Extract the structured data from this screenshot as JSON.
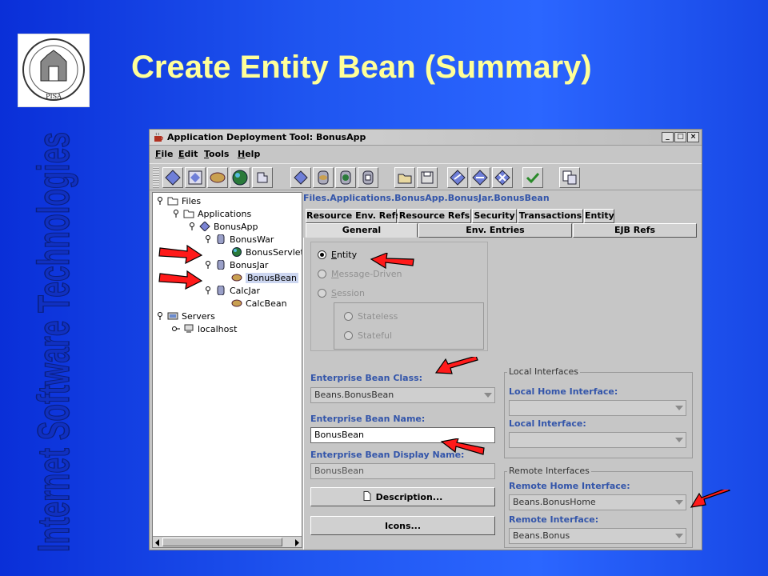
{
  "slide": {
    "title": "Create Entity Bean (Summary)",
    "side_title": "Internet Software Technologies",
    "logo_text": "PISA"
  },
  "window": {
    "title": "Application Deployment Tool: BonusApp",
    "controls": [
      "_",
      "□",
      "×"
    ],
    "menus": [
      {
        "letter": "F",
        "rest": "ile"
      },
      {
        "letter": "E",
        "rest": "dit"
      },
      {
        "letter": "T",
        "rest": "ools"
      },
      {
        "letter": "H",
        "rest": "elp"
      }
    ]
  },
  "tree": {
    "files": "Files",
    "applications": "Applications",
    "bonusapp": "BonusApp",
    "bonuswar": "BonusWar",
    "bonusservlet": "BonusServlet",
    "bonusjar": "BonusJar",
    "bonusbean": "BonusBean",
    "calcjar": "CalcJar",
    "calcbean": "CalcBean",
    "servers": "Servers",
    "localhost": "localhost"
  },
  "panel": {
    "path": "Files.Applications.BonusApp.BonusJar.BonusBean",
    "tabs_row1": [
      "Resource Env. Refs",
      "Resource Refs",
      "Security",
      "Transactions",
      "Entity"
    ],
    "tabs_row2": [
      "General",
      "Env. Entries",
      "EJB Refs"
    ],
    "radios": {
      "entity": {
        "letter": "E",
        "rest": "ntity"
      },
      "message": {
        "letter": "M",
        "rest": "essage-Driven"
      },
      "session": {
        "letter": "S",
        "rest": "ession"
      },
      "stateless": "Stateless",
      "stateful": "Stateful"
    },
    "ejb_class_label": "Enterprise Bean Class:",
    "ejb_class_value": "Beans.BonusBean",
    "ejb_name_label": "Enterprise Bean Name:",
    "ejb_name_value": "BonusBean",
    "ejb_display_label": "Enterprise Bean Display Name:",
    "ejb_display_value": "BonusBean",
    "description_button": "Description...",
    "icons_button": "Icons...",
    "local_group": "Local Interfaces",
    "local_home_label": "Local Home Interface:",
    "local_label": "Local Interface:",
    "remote_group": "Remote Interfaces",
    "remote_home_label": "Remote Home Interface:",
    "remote_home_value": "Beans.BonusHome",
    "remote_label": "Remote Interface:",
    "remote_value": "Beans.Bonus"
  },
  "colors": {
    "title": "#ffff99",
    "arrow": "#ff1a1a",
    "label": "#3355aa"
  }
}
